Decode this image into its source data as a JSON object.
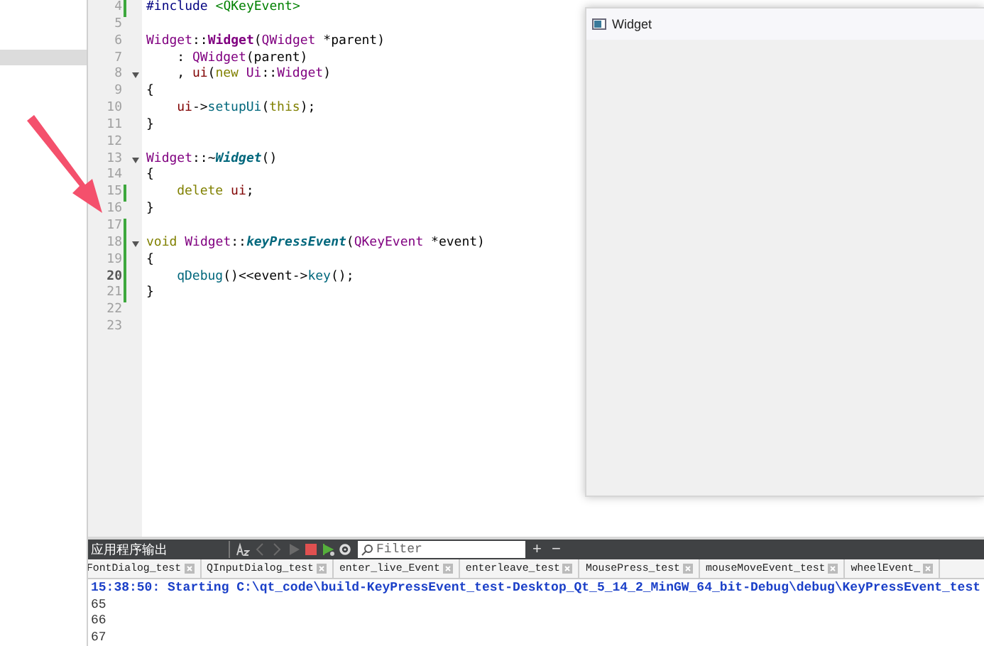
{
  "editor": {
    "lines": [
      {
        "number": "4",
        "changed": true,
        "fold": false,
        "current": false,
        "indented": false,
        "tokens": [
          {
            "kind": "pre",
            "t": "#include"
          },
          {
            "kind": "str",
            "t": " <QKeyEvent>"
          }
        ]
      },
      {
        "number": "5",
        "changed": false,
        "fold": false,
        "current": false
      },
      {
        "number": "6",
        "changed": false,
        "fold": false,
        "current": false,
        "indented": false,
        "tokens": [
          {
            "kind": "type",
            "t": "Widget"
          },
          {
            "kind": "plain",
            "t": "::"
          },
          {
            "kind": "fn",
            "t": "Widget"
          },
          {
            "kind": "plain",
            "t": "("
          },
          {
            "kind": "type",
            "t": "QWidget"
          },
          {
            "kind": "plain",
            "t": " *parent)"
          }
        ]
      },
      {
        "number": "7",
        "changed": false,
        "fold": false,
        "current": false,
        "indented": true,
        "tokens": [
          {
            "kind": "plain",
            "t": ": "
          },
          {
            "kind": "type",
            "t": "QWidget"
          },
          {
            "kind": "plain",
            "t": "(parent)"
          }
        ]
      },
      {
        "number": "8",
        "changed": false,
        "fold": true,
        "current": false,
        "indented": true,
        "tokens": [
          {
            "kind": "plain",
            "t": ", "
          },
          {
            "kind": "member",
            "t": "ui"
          },
          {
            "kind": "plain",
            "t": "("
          },
          {
            "kind": "kw",
            "t": "new"
          },
          {
            "kind": "type",
            "t": " Ui"
          },
          {
            "kind": "plain",
            "t": "::"
          },
          {
            "kind": "type",
            "t": "Widget"
          },
          {
            "kind": "plain",
            "t": ")"
          }
        ]
      },
      {
        "number": "9",
        "changed": false,
        "fold": false,
        "current": false,
        "indented": false,
        "tokens": [
          {
            "kind": "plain",
            "t": "{"
          }
        ]
      },
      {
        "number": "10",
        "changed": false,
        "fold": false,
        "current": false,
        "indented": true,
        "tokens": [
          {
            "kind": "member",
            "t": "ui"
          },
          {
            "kind": "plain",
            "t": "->"
          },
          {
            "kind": "call",
            "t": "setupUi"
          },
          {
            "kind": "plain",
            "t": "("
          },
          {
            "kind": "kw",
            "t": "this"
          },
          {
            "kind": "plain",
            "t": ");"
          }
        ]
      },
      {
        "number": "11",
        "changed": false,
        "fold": false,
        "current": false,
        "indented": false,
        "tokens": [
          {
            "kind": "plain",
            "t": "}"
          }
        ]
      },
      {
        "number": "12",
        "changed": false,
        "fold": false,
        "current": false
      },
      {
        "number": "13",
        "changed": false,
        "fold": true,
        "current": false,
        "indented": false,
        "tokens": [
          {
            "kind": "type",
            "t": "Widget"
          },
          {
            "kind": "plain",
            "t": "::~"
          },
          {
            "kind": "fnit",
            "t": "Widget"
          },
          {
            "kind": "plain",
            "t": "()"
          }
        ]
      },
      {
        "number": "14",
        "changed": false,
        "fold": false,
        "current": false,
        "indented": false,
        "tokens": [
          {
            "kind": "plain",
            "t": "{"
          }
        ]
      },
      {
        "number": "15",
        "changed": true,
        "fold": false,
        "current": false,
        "indented": true,
        "tokens": [
          {
            "kind": "kw",
            "t": "delete"
          },
          {
            "kind": "member",
            "t": " ui"
          },
          {
            "kind": "plain",
            "t": ";"
          }
        ]
      },
      {
        "number": "16",
        "changed": false,
        "fold": false,
        "current": false,
        "indented": false,
        "tokens": [
          {
            "kind": "plain",
            "t": "}"
          }
        ]
      },
      {
        "number": "17",
        "changed": true,
        "fold": false,
        "current": false
      },
      {
        "number": "18",
        "changed": true,
        "fold": true,
        "current": false,
        "indented": false,
        "tokens": [
          {
            "kind": "kw",
            "t": "void"
          },
          {
            "kind": "type",
            "t": " Widget"
          },
          {
            "kind": "plain",
            "t": "::"
          },
          {
            "kind": "fnit",
            "t": "keyPressEvent"
          },
          {
            "kind": "plain",
            "t": "("
          },
          {
            "kind": "type",
            "t": "QKeyEvent"
          },
          {
            "kind": "plain",
            "t": " *event)"
          }
        ]
      },
      {
        "number": "19",
        "changed": true,
        "fold": false,
        "current": false,
        "indented": false,
        "tokens": [
          {
            "kind": "plain",
            "t": "{"
          }
        ]
      },
      {
        "number": "20",
        "changed": true,
        "fold": false,
        "current": true,
        "indented": true,
        "tokens": [
          {
            "kind": "call",
            "t": "qDebug"
          },
          {
            "kind": "plain",
            "t": "()<<event->"
          },
          {
            "kind": "call",
            "t": "key"
          },
          {
            "kind": "plain",
            "t": "();"
          }
        ]
      },
      {
        "number": "21",
        "changed": true,
        "fold": false,
        "current": false,
        "indented": false,
        "tokens": [
          {
            "kind": "plain",
            "t": "}"
          }
        ]
      },
      {
        "number": "22",
        "changed": false,
        "fold": false,
        "current": false
      },
      {
        "number": "23",
        "changed": false,
        "fold": false,
        "current": false
      }
    ]
  },
  "widget_window": {
    "title": "Widget"
  },
  "output_pane": {
    "title": "应用程序输出",
    "filter": {
      "placeholder": "Filter"
    },
    "add": "+",
    "remove": "−",
    "tabs": [
      {
        "label": "FontDialog_test"
      },
      {
        "label": "QInputDialog_test"
      },
      {
        "label": "enter_live_Event"
      },
      {
        "label": "enterleave_test"
      },
      {
        "label": "MousePress_test"
      },
      {
        "label": "mouseMoveEvent_test"
      },
      {
        "label": "wheelEvent_"
      }
    ],
    "lines": [
      {
        "kind": "status",
        "text": "15:38:50: Starting C:\\qt_code\\build-KeyPressEvent_test-Desktop_Qt_5_14_2_MinGW_64_bit-Debug\\debug\\KeyPressEvent_test"
      },
      {
        "kind": "plain",
        "text": "65"
      },
      {
        "kind": "plain",
        "text": "66"
      },
      {
        "kind": "plain",
        "text": "67"
      }
    ]
  }
}
